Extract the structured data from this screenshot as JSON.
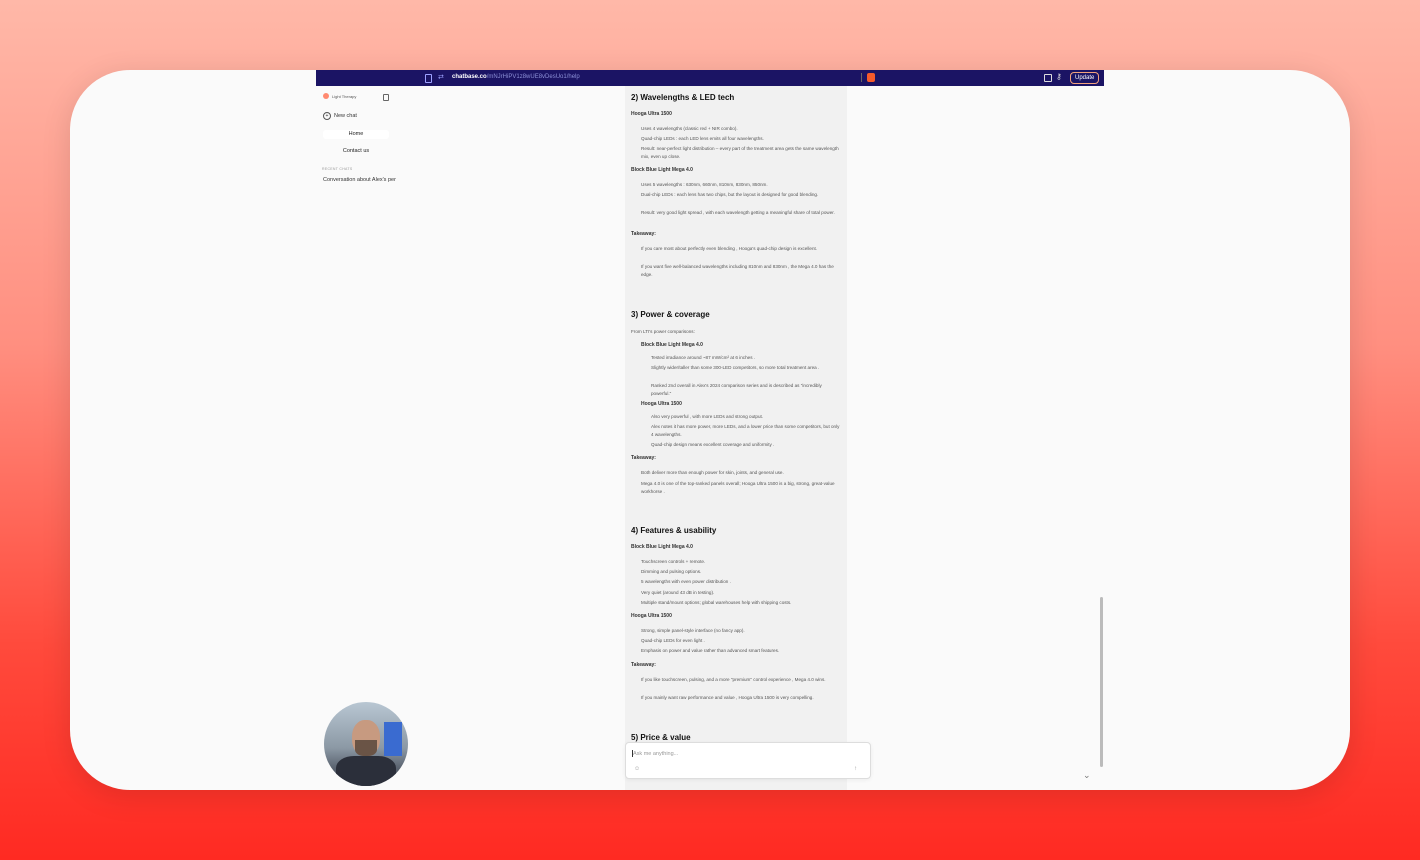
{
  "browser": {
    "url_host": "chatbase.co",
    "url_path": "/mNJrHiPV1z8wUE8vDesUo1/help",
    "update_label": "Update"
  },
  "sidebar": {
    "brand": "Light Therapy",
    "new_chat": "New chat",
    "nav": [
      {
        "label": "Home"
      },
      {
        "label": "Contact us"
      }
    ],
    "recent_title": "RECENT CHATS",
    "recent": [
      {
        "label": "Conversation about Alex's per"
      }
    ]
  },
  "content": {
    "s2": {
      "title": "2) Wavelengths & LED tech",
      "hooga_title": "Hooga Ultra 1500",
      "hooga_p1": "Uses 4 wavelengths (classic red + NIR combo).",
      "hooga_p2": "Quad-chip LEDs : each LED lens emits all four wavelengths.",
      "hooga_p3": "Result: near-perfect light distribution – every part of the treatment area gets the same wavelength mix, even up close.",
      "mega_title": "Block Blue Light Mega 4.0",
      "mega_p1": "Uses 5 wavelengths : 630nm, 660nm, 810nm, 830nm, 850nm.",
      "mega_p2": "Dual-chip LEDs : each lens has two chips, but the layout is designed for good blending.",
      "mega_p3": "Result: very good light spread , with each wavelength getting a meaningful share of total power.",
      "takeaway": "Takeaway:",
      "t1": "If you care most about perfectly even blending , Hooga's quad-chip design is excellent.",
      "t2": "If you want five well-balanced wavelengths including 810nm and 830nm , the Mega 4.0 has the edge."
    },
    "s3": {
      "title": "3) Power & coverage",
      "intro": "From LTI's power comparisons:",
      "mega_title": "Block Blue Light Mega 4.0",
      "mega_p1": "Tested irradiance around ~87 mW/cm² at 6 inches .",
      "mega_p2": "Slightly wider/taller than some 300-LED competitors, so more total treatment area .",
      "mega_p3": "Ranked 2nd overall in Alex's 2024 comparison series and is described as \"incredibly powerful.\"",
      "hooga_title": "Hooga Ultra 1500",
      "hooga_p1": "Also very powerful , with more LEDs and strong output.",
      "hooga_p2": "Alex notes it has more power, more LEDs, and a lower price than some competitors, but only 4 wavelengths.",
      "hooga_p3": "Quad-chip design means excellent coverage and uniformity .",
      "takeaway": "Takeaway:",
      "t1": "Both deliver more than enough power for skin, joints, and general use.",
      "t2": "Mega 4.0 is one of the top-ranked panels overall; Hooga Ultra 1500 is a big, strong, great-value workhorse ."
    },
    "s4": {
      "title": "4) Features & usability",
      "mega_title": "Block Blue Light Mega 4.0",
      "mega_items": [
        "Touchscreen controls + remote.",
        "Dimming and pulsing options.",
        "5 wavelengths with even power distribution .",
        "Very quiet (around 43 dB in testing).",
        "Multiple stand/mount options; global warehouses help with shipping costs."
      ],
      "hooga_title": "Hooga Ultra 1500",
      "hooga_items": [
        "Strong, simple panel-style interface (no fancy app).",
        "Quad-chip LEDs for even light .",
        "Emphasis on power and value rather than advanced smart features."
      ],
      "takeaway": "Takeaway:",
      "t1": "If you like touchscreen, pulsing, and a more \"premium\" control experience , Mega 4.0 wins.",
      "t2": "If you mainly want raw performance and value , Hooga Ultra 1500 is very compelling."
    },
    "s5": {
      "title": "5) Price & value"
    }
  },
  "composer": {
    "placeholder": "Ask me anything..."
  },
  "colors": {
    "browser_bar": "#1b1464",
    "brand_accent": "#ff8a70",
    "background_gradient_top": "#ffb8a8",
    "background_gradient_bottom": "#ff2a22"
  },
  "icons": [
    "tab-icon",
    "tune-icon",
    "brave-icon",
    "sidebar-toggle-icon",
    "key-icon",
    "collapse-icon",
    "plus-circle-icon",
    "emoji-icon",
    "send-icon",
    "chevron-down-icon"
  ]
}
